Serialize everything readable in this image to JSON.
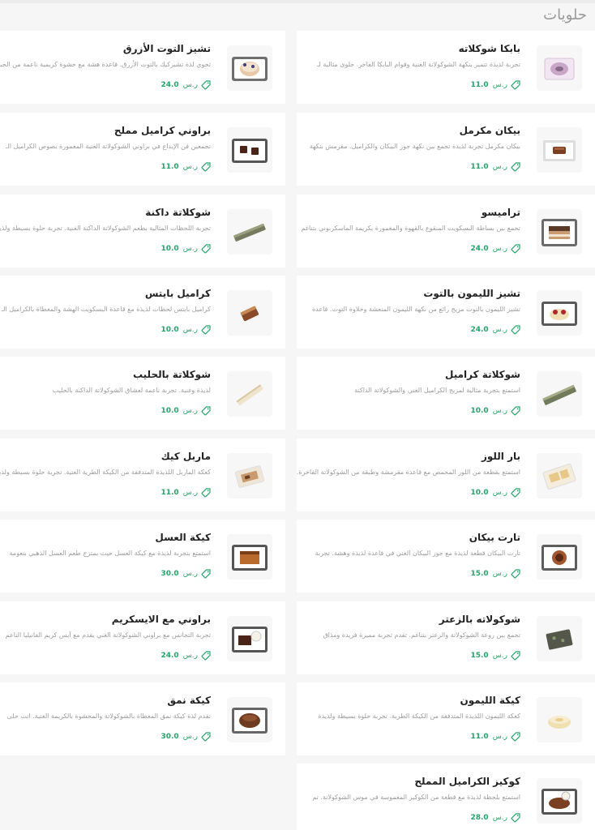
{
  "section": {
    "title": "حلويات"
  },
  "items": [
    {
      "name": "بابكا شوكلاته",
      "desc": "تجربة لذيذة تتميز بنكهة الشوكولاتة الغنية وقوام البابكا الفاخر. حلوى مثالية لـ",
      "price": "11.0",
      "currency": "ر.س",
      "image": "babka"
    },
    {
      "name": "تشيز التوت الأزرق",
      "desc": "تحوي لذة تشيزكيك بالتوت الأزرق. قاعدة هشة مع حشوة كريمية ناعمة من الجبنة وطبقة",
      "price": "24.0",
      "currency": "ر.س",
      "image": "blueberry-cheesecake"
    },
    {
      "name": "بيكان مكرمل",
      "desc": "بيكان مكرمل تجربة لذيذة تجمع بين نكهة جوز البيكان والكراميل. مقرمش بنكهة",
      "price": "11.0",
      "currency": "ر.س",
      "image": "caramel-pecan"
    },
    {
      "name": "براوني كراميل مملح",
      "desc": "تجمعين فن الإبداع في براوني الشوكولاتة الغنية المغمورة بصوص الكراميل الـ",
      "price": "11.0",
      "currency": "ر.س",
      "image": "salted-caramel-brownie"
    },
    {
      "name": "تراميسو",
      "desc": "تجمع بين بساطة البسكويت المنقوع بالقهوة والمغمورة بكريمة الماسكربوني بتناغم",
      "price": "24.0",
      "currency": "ر.س",
      "image": "tiramisu"
    },
    {
      "name": "شوكلاتة داكنة",
      "desc": "تجربة اللحظات المثالية بطعم الشوكولاتة الداكنة الغنية. تجربة حلوة بسيطة ولذيذة",
      "price": "10.0",
      "currency": "ر.س",
      "image": "dark-chocolate"
    },
    {
      "name": "تشيز الليمون بالتوت",
      "desc": "تشيز الليمون بالتوت مزيج رائع من نكهة الليمون المنعشة وحلاوة التوت. قاعدة",
      "price": "24.0",
      "currency": "ر.س",
      "image": "lemon-berry-cheesecake"
    },
    {
      "name": "كراميل بايتس",
      "desc": "كراميل بايتس لحظات لذيذة مع قاعدة البسكويت الهشة والمغطاة بالكراميل الـ",
      "price": "10.0",
      "currency": "ر.س",
      "image": "caramel-bites"
    },
    {
      "name": "شوكلاتة كراميل",
      "desc": "استمتع بتجربة مثالية لمزيج الكراميل الغني والشوكولاتة الداكنة",
      "price": "10.0",
      "currency": "ر.س",
      "image": "caramel-chocolate"
    },
    {
      "name": "شوكلاتة بالحليب",
      "desc": "لذيذة وغنية. تجربة ناعمة لعشاق الشوكولاتة الداكنة بالحليب",
      "price": "10.0",
      "currency": "ر.س",
      "image": "milk-chocolate"
    },
    {
      "name": "بار اللوز",
      "desc": "استمتع بقطعة من اللوز المحمص مع قاعدة مقرمشة وطبقة من الشوكولاتة الفاخرة. تجربة",
      "price": "10.0",
      "currency": "ر.س",
      "image": "almond-bar"
    },
    {
      "name": "ماربل كيك",
      "desc": "كعكة الماربل اللذيذة المتدفقة من الكيكة الطرية الغنية. تجربة حلوة بسيطة ولذيذة",
      "price": "11.0",
      "currency": "ر.س",
      "image": "marble-cake"
    },
    {
      "name": "تارت بيكان",
      "desc": "تارت البيكان قطعة لذيذة مع جوز البيكان الغني في قاعدة لذيذة وهشة. تجربة",
      "price": "15.0",
      "currency": "ر.س",
      "image": "pecan-tart"
    },
    {
      "name": "كيكة العسل",
      "desc": "استمتع بتجربة لذيذة مع كيكة العسل حيث يمتزج طعم العسل الذهبي بنعومة",
      "price": "30.0",
      "currency": "ر.س",
      "image": "honey-cake"
    },
    {
      "name": "شوكولاته بالزعتر",
      "desc": "تجمع بين روعة الشوكولاتة والزعتر بتناغم. تقدم تجربة مميزة فريدة ومذاق",
      "price": "15.0",
      "currency": "ر.س",
      "image": "thyme-chocolate"
    },
    {
      "name": "براوني مع الايسكريم",
      "desc": "تجربة التجانس مع براوني الشوكولاتة الغني يقدم مع آيس كريم الفانيليا الناعم",
      "price": "24.0",
      "currency": "ر.س",
      "image": "brownie-icecream"
    },
    {
      "name": "كيكة الليمون",
      "desc": "كعكة الليمون اللذيذة المتدفقة من الكيكة الطرية. تجربة حلوة بسيطة ولذيذة",
      "price": "11.0",
      "currency": "ر.س",
      "image": "lemon-cake"
    },
    {
      "name": "كيكة نمق",
      "desc": "تقدم لذة كيكة نمق المغطاة بالشوكولاتة والمحشوة بالكريمة الغنية. انت حلى",
      "price": "30.0",
      "currency": "ر.س",
      "image": "namaq-cake"
    },
    {
      "name": "كوكيز الكراميل المملح",
      "desc": "استمتع بلحظة لذيذة مع قطعة من الكوكيز المغموسة في موس الشوكولاتة. تم",
      "price": "28.0",
      "currency": "ر.س",
      "image": "salted-caramel-cookies"
    }
  ]
}
